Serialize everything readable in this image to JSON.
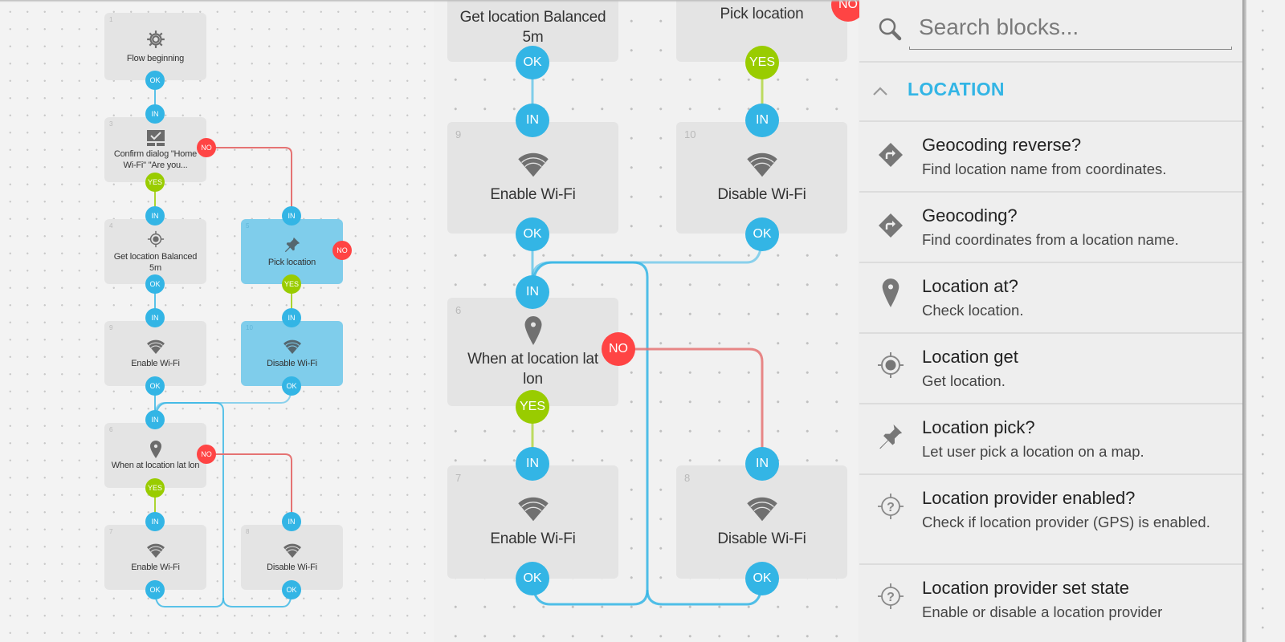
{
  "colors": {
    "accent": "#33b5e5",
    "port_in_ok": "#33b5e5",
    "port_yes": "#99cc00",
    "port_no": "#ff4444",
    "wire_ok": "#33b5e5",
    "wire_yes": "#99cc00",
    "wire_no": "#e57373",
    "block_bg": "#e4e4e4",
    "block_selected_bg": "#7fcdeb"
  },
  "ports": {
    "in": "IN",
    "ok": "OK",
    "yes": "YES",
    "no": "NO"
  },
  "overview": {
    "blocks": [
      {
        "id": "1",
        "label": "Flow beginning",
        "icon": "gear-icon",
        "selected": false
      },
      {
        "id": "3",
        "label": "Confirm dialog \"Home Wi-Fi\" \"Are you...",
        "icon": "dialog-check-icon",
        "selected": false
      },
      {
        "id": "4",
        "label": "Get location Balanced 5m",
        "icon": "crosshair-icon",
        "selected": false
      },
      {
        "id": "5",
        "label": "Pick location",
        "icon": "pushpin-icon",
        "selected": true
      },
      {
        "id": "9",
        "label": "Enable Wi-Fi",
        "icon": "wifi-icon",
        "selected": false
      },
      {
        "id": "10",
        "label": "Disable Wi-Fi",
        "icon": "wifi-icon",
        "selected": true
      },
      {
        "id": "6",
        "label": "When at location lat lon",
        "icon": "map-pin-icon",
        "selected": false
      },
      {
        "id": "7",
        "label": "Enable Wi-Fi",
        "icon": "wifi-icon",
        "selected": false
      },
      {
        "id": "8",
        "label": "Disable Wi-Fi",
        "icon": "wifi-icon",
        "selected": false
      }
    ]
  },
  "zoomed": {
    "blocks": [
      {
        "id": "4",
        "label": "Get location Balanced 5m"
      },
      {
        "id": "5",
        "label": "Pick location"
      },
      {
        "id": "9",
        "label": "Enable Wi-Fi"
      },
      {
        "id": "10",
        "label": "Disable Wi-Fi"
      },
      {
        "id": "6",
        "label": "When at location lat lon"
      },
      {
        "id": "7",
        "label": "Enable Wi-Fi"
      },
      {
        "id": "8",
        "label": "Disable Wi-Fi"
      }
    ]
  },
  "sidebar": {
    "search_placeholder": "Search blocks...",
    "category": "LOCATION",
    "items": [
      {
        "title": "Geocoding reverse?",
        "desc": "Find location name from coordinates.",
        "icon": "directions-diamond-icon"
      },
      {
        "title": "Geocoding?",
        "desc": "Find coordinates from a location name.",
        "icon": "directions-diamond-icon"
      },
      {
        "title": "Location at?",
        "desc": "Check location.",
        "icon": "map-pin-icon"
      },
      {
        "title": "Location get",
        "desc": "Get location.",
        "icon": "crosshair-icon"
      },
      {
        "title": "Location pick?",
        "desc": "Let user pick a location on a map.",
        "icon": "pushpin-icon"
      },
      {
        "title": "Location provider enabled?",
        "desc": "Check if location provider (GPS) is enabled.",
        "icon": "crosshair-question-icon"
      },
      {
        "title": "Location provider set state",
        "desc": "Enable or disable a location provider",
        "icon": "crosshair-question-icon"
      }
    ]
  }
}
